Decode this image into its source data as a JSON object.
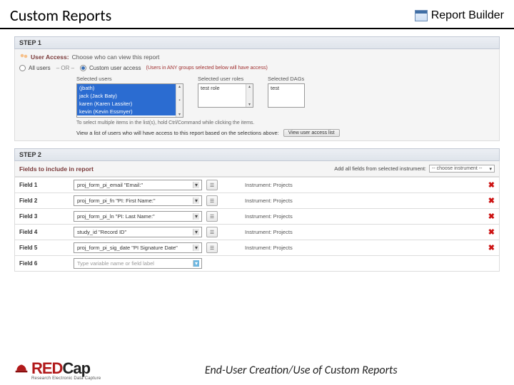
{
  "header": {
    "title": "Custom Reports",
    "reportBuilder": "Report Builder"
  },
  "step1": {
    "label": "STEP 1",
    "userAccessLabel": "User Access:",
    "userAccessText": "Choose who can view this report",
    "allUsers": "All users",
    "or": "– OR –",
    "customUserAccess": "Custom user access",
    "customNote": "(Users in ANY groups selected below will have access)",
    "selectedUsersTitle": "Selected users",
    "users": [
      "(jbath)",
      "jack (Jack Baty)",
      "karen (Karen Lassiter)",
      "kevin (Kevin Essmyer)"
    ],
    "selectedRolesTitle": "Selected user roles",
    "roles": [
      "test role"
    ],
    "selectedDagsTitle": "Selected DAGs",
    "dags": [
      "test"
    ],
    "multiHint": "To select multiple items in the list(s), hold Ctrl/Command while clicking the items.",
    "viewText": "View a list of users who will have access to this report based on the selections above:",
    "viewBtn": "View user access list"
  },
  "step2": {
    "label": "STEP 2",
    "heading": "Fields to include in report",
    "addAllLabel": "Add all fields from selected instrument:",
    "chooseInstrument": "-- choose instrument --",
    "fields": [
      {
        "label": "Field 1",
        "value": "proj_form_pi_email \"Email:\"",
        "instrument": "Instrument: Projects"
      },
      {
        "label": "Field 2",
        "value": "proj_form_pi_fn \"PI: First Name:\"",
        "instrument": "Instrument: Projects"
      },
      {
        "label": "Field 3",
        "value": "proj_form_pi_ln \"PI: Last Name:\"",
        "instrument": "Instrument: Projects"
      },
      {
        "label": "Field 4",
        "value": "study_id \"Record ID\"",
        "instrument": "Instrument: Projects"
      },
      {
        "label": "Field 5",
        "value": "proj_form_pi_sig_date \"PI Signature Date\"",
        "instrument": "Instrument: Projects"
      }
    ],
    "emptyField": {
      "label": "Field 6",
      "placeholder": "Type variable name or field label"
    }
  },
  "footer": {
    "logoRed": "RED",
    "logoBlack": "Cap",
    "tagline": "Research Electronic Data Capture",
    "caption": "End-User Creation/Use of Custom Reports"
  }
}
